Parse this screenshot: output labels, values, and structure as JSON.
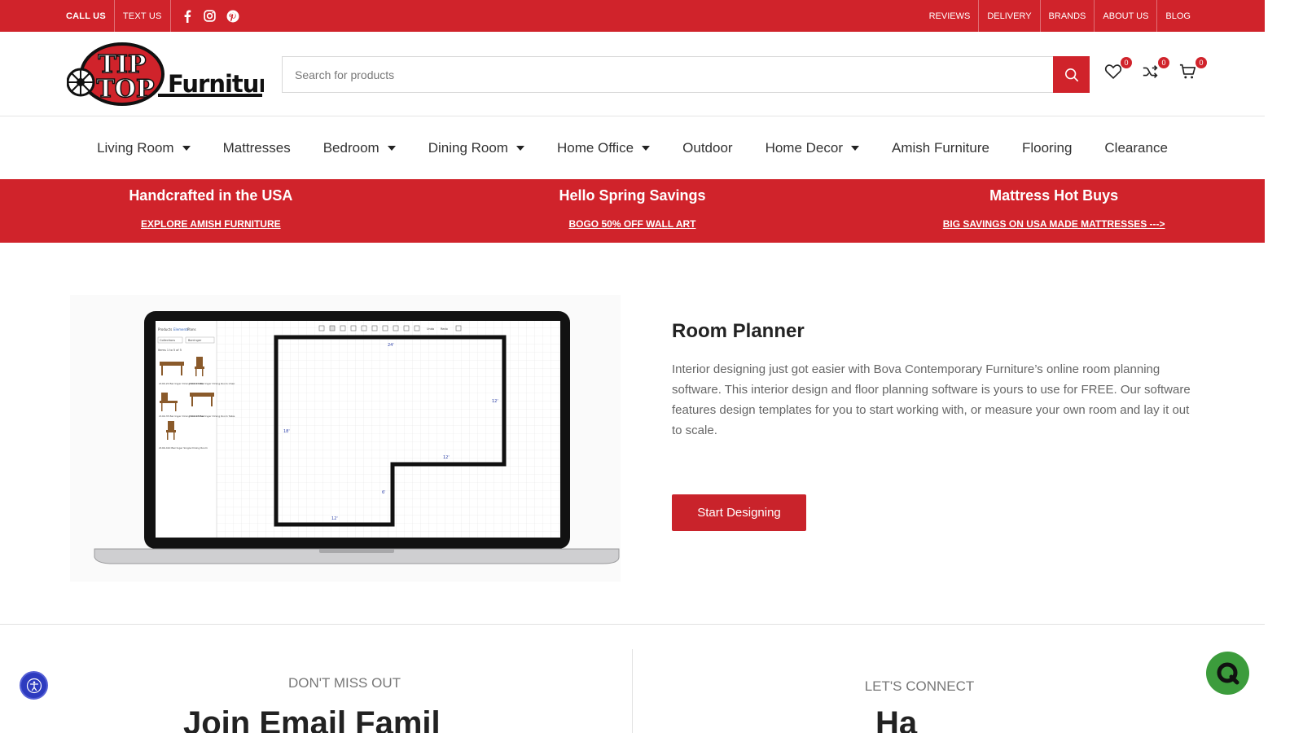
{
  "topbar": {
    "call_label": "CALL US",
    "text_label": "TEXT US",
    "social_icons": [
      "facebook-icon",
      "instagram-icon",
      "pinterest-icon"
    ],
    "links": [
      "REVIEWS",
      "DELIVERY",
      "BRANDS",
      "ABOUT US",
      "BLOG"
    ]
  },
  "header": {
    "logo_text": "TipTop Furniture",
    "search_placeholder": "Search for products",
    "wishlist_count": "0",
    "compare_count": "0",
    "cart_count": "0"
  },
  "nav": {
    "items": [
      {
        "label": "Living Room",
        "has_dropdown": true
      },
      {
        "label": "Mattresses",
        "has_dropdown": false
      },
      {
        "label": "Bedroom",
        "has_dropdown": true
      },
      {
        "label": "Dining Room",
        "has_dropdown": true
      },
      {
        "label": "Home Office",
        "has_dropdown": true
      },
      {
        "label": "Outdoor",
        "has_dropdown": false
      },
      {
        "label": "Home Decor",
        "has_dropdown": true
      },
      {
        "label": "Amish Furniture",
        "has_dropdown": false
      },
      {
        "label": "Flooring",
        "has_dropdown": false
      },
      {
        "label": "Clearance",
        "has_dropdown": false
      }
    ]
  },
  "promos": [
    {
      "heading": "Handcrafted in the USA",
      "link": "EXPLORE AMISH FURNITURE"
    },
    {
      "heading": "Hello Spring Savings",
      "link": "BOGO 50% OFF WALL ART"
    },
    {
      "heading": "Mattress Hot Buys",
      "link": "BIG SAVINGS ON USA MADE MATTRESSES --->"
    }
  ],
  "planner": {
    "title": "Room Planner",
    "description": "Interior designing just got easier with Bova Contemporary Furniture’s online room planning software. This interior design and floor planning software is yours to use for FREE. Our software features design templates for you to start working with, or measure your own room and lay it out to scale.",
    "button": "Start Designing",
    "screen": {
      "tabs": [
        "Products",
        "Elements",
        "Plans"
      ],
      "filter_label": "Collections",
      "filter_value": "Barringer",
      "items_label": "Items 1 to 5 of 5",
      "products": [
        "2199-20 Barringer Dining Room Sets",
        "2199-21 Barringer Dining Room Chair",
        "2199-35 Barringer Dining Room Chair",
        "2199-28 Barringer Dining Room Table",
        "2199-410 Barringer Single Dining Room"
      ],
      "toolbar_labels": [
        "Undo",
        "Redo"
      ],
      "dims": [
        "24'",
        "12'",
        "18'",
        "12'",
        "6'",
        "12'"
      ]
    },
    "colors": {
      "accent": "#d0232b",
      "button": "#c9232b"
    }
  },
  "footer": {
    "dont_miss": "DON'T MISS OUT",
    "join_heading": "Join Email Famil",
    "lets_connect": "LET'S CONNECT",
    "connect_heading": "Ha"
  },
  "widgets": {
    "accessibility_icon": "accessibility-icon",
    "chat_icon": "chat-icon"
  }
}
